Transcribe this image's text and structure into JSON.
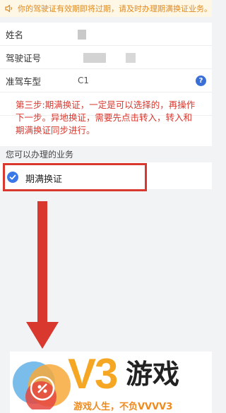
{
  "notice": {
    "icon": "speaker-icon",
    "text": "你的驾驶证有效期即将过期，请及时办理期满换证业务。"
  },
  "form": {
    "rows": [
      {
        "label": "姓名"
      },
      {
        "label": "驾驶证号"
      },
      {
        "label": "准驾车型",
        "value": "C1"
      },
      {
        "label": ""
      },
      {
        "label": ""
      }
    ]
  },
  "annotation": "第三步:期满换证，一定是可以选择的，再操作下一步。异地换证，需要先点击转入，转入和期满换证同步进行。",
  "section_title": "您可以办理的业务",
  "business_option": {
    "label": "期满换证",
    "checked": true
  },
  "colors": {
    "accent_blue": "#3b78e7",
    "annotation_red": "#d8382e",
    "notice_text": "#e08a1e",
    "watermark_orange": "#f5a623"
  },
  "watermark": {
    "brand_v3": "V3",
    "brand_game": "游戏",
    "slogan": "游戏人生，不负VVVV3"
  }
}
